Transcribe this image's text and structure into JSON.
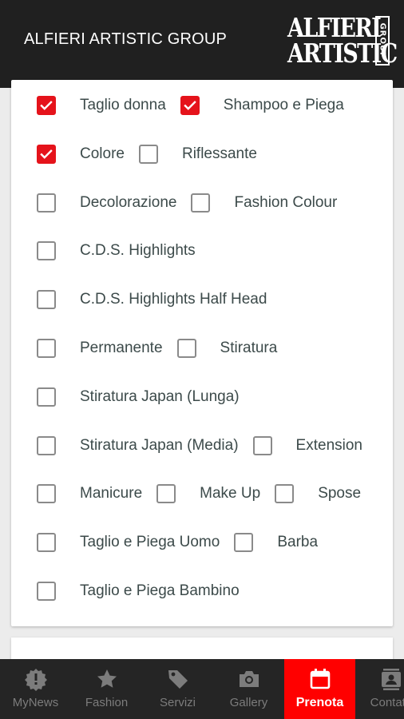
{
  "header": {
    "title": "ALFIERI ARTISTIC GROUP",
    "logo_line1": "ALFIERI",
    "logo_line2": "ARTISTIC",
    "logo_group": "GROUP"
  },
  "services": [
    [
      {
        "label": "Taglio donna",
        "checked": true
      },
      {
        "label": "Shampoo e Piega",
        "checked": true
      }
    ],
    [
      {
        "label": "Colore",
        "checked": true
      },
      {
        "label": "Riflessante",
        "checked": false
      }
    ],
    [
      {
        "label": "Decolorazione",
        "checked": false
      },
      {
        "label": "Fashion Colour",
        "checked": false
      }
    ],
    [
      {
        "label": "C.D.S. Highlights",
        "checked": false
      }
    ],
    [
      {
        "label": "C.D.S. Highlights Half Head",
        "checked": false
      }
    ],
    [
      {
        "label": "Permanente",
        "checked": false
      },
      {
        "label": "Stiratura",
        "checked": false
      }
    ],
    [
      {
        "label": "Stiratura Japan (Lunga)",
        "checked": false
      }
    ],
    [
      {
        "label": "Stiratura Japan (Media)",
        "checked": false
      },
      {
        "label": "Extension",
        "checked": false
      }
    ],
    [
      {
        "label": "Manicure",
        "checked": false
      },
      {
        "label": "Make Up",
        "checked": false
      },
      {
        "label": "Spose",
        "checked": false
      }
    ],
    [
      {
        "label": "Taglio e Piega Uomo",
        "checked": false
      },
      {
        "label": "Barba",
        "checked": false
      }
    ],
    [
      {
        "label": "Taglio e Piega Bambino",
        "checked": false
      }
    ]
  ],
  "nav": [
    {
      "label": "MyNews",
      "icon": "badge-alert-icon",
      "active": false
    },
    {
      "label": "Fashion",
      "icon": "star-icon",
      "active": false
    },
    {
      "label": "Servizi",
      "icon": "tag-icon",
      "active": false
    },
    {
      "label": "Gallery",
      "icon": "camera-icon",
      "active": false
    },
    {
      "label": "Prenota",
      "icon": "calendar-icon",
      "active": true
    },
    {
      "label": "Contatti",
      "icon": "contacts-icon",
      "active": false
    }
  ],
  "colors": {
    "accent": "#e5131b",
    "header_bg": "#202020",
    "nav_bg": "#252525",
    "nav_active": "#ff0000"
  }
}
